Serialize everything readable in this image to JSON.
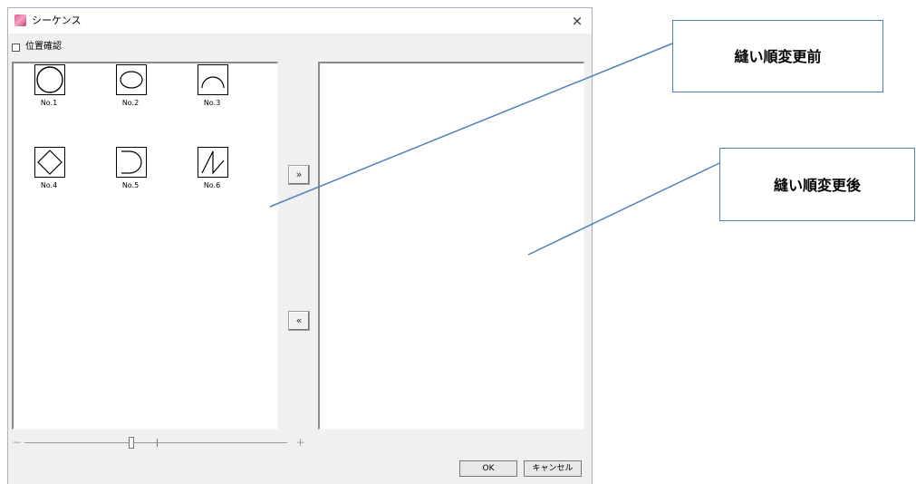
{
  "window": {
    "title": "シーケンス",
    "close_glyph": "×"
  },
  "options": {
    "position_check_label": "位置確認"
  },
  "source_list": {
    "items": [
      {
        "label": "No.1",
        "shape": "circle"
      },
      {
        "label": "No.2",
        "shape": "ellipse"
      },
      {
        "label": "No.3",
        "shape": "arc"
      },
      {
        "label": "No.4",
        "shape": "diamond"
      },
      {
        "label": "No.5",
        "shape": "d-shape"
      },
      {
        "label": "No.6",
        "shape": "zigzag"
      }
    ]
  },
  "transfer": {
    "add_label": "»",
    "remove_label": "«"
  },
  "zoom": {
    "minus": "－",
    "plus": "＋"
  },
  "buttons": {
    "ok": "OK",
    "cancel": "キャンセル"
  },
  "callouts": {
    "before": "縫い順変更前",
    "after": "縫い順変更後"
  },
  "colors": {
    "accent": "#4f81bd"
  }
}
